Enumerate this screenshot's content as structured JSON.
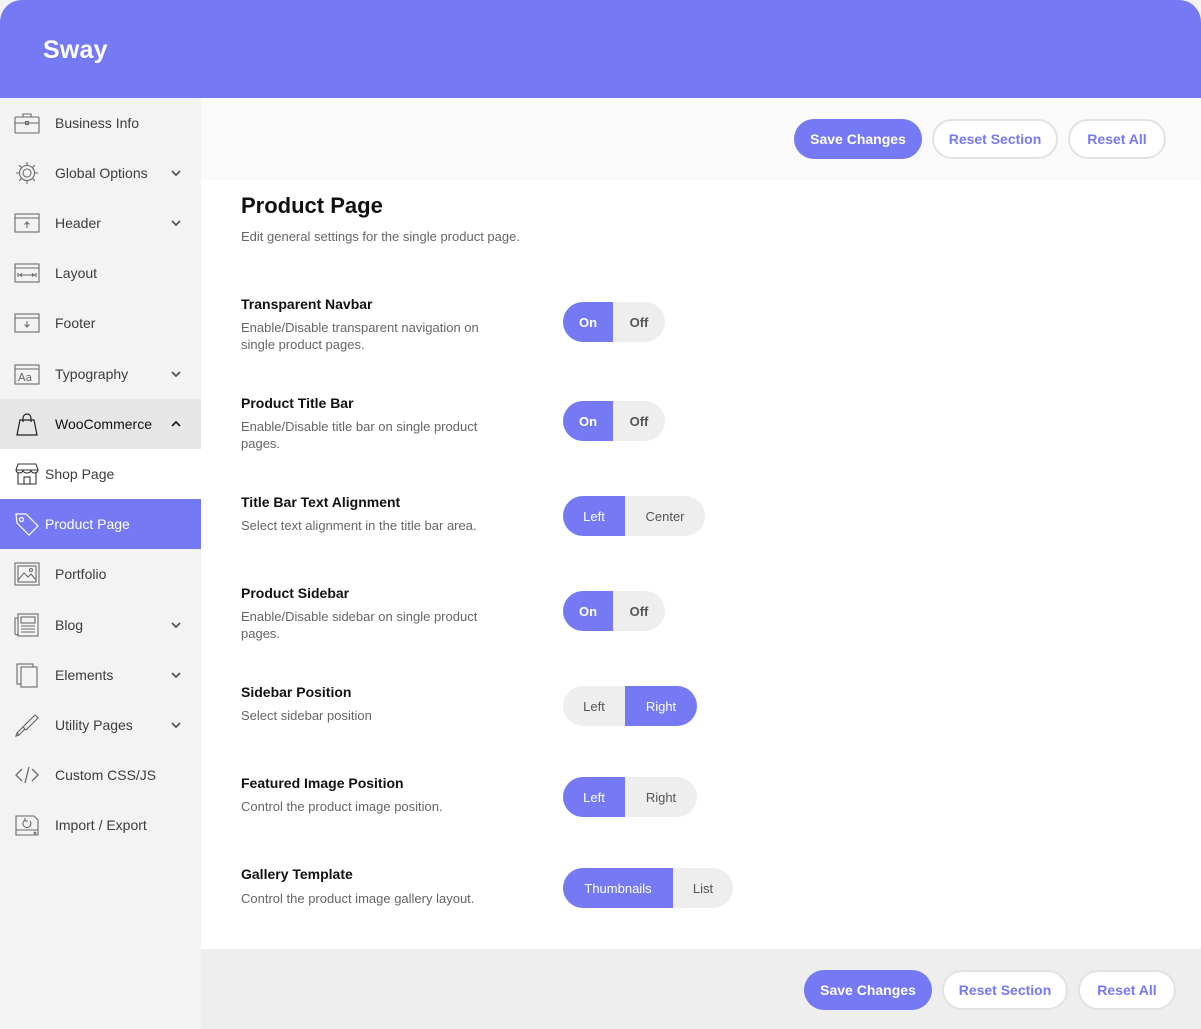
{
  "app": {
    "title": "Sway"
  },
  "colors": {
    "accent": "#7579f3",
    "sidebar_bg": "#f3f3f3",
    "panel_bg": "#ffffff"
  },
  "sidebar": {
    "items": [
      {
        "label": "Business Info",
        "icon": "briefcase-icon",
        "has_chevron": false
      },
      {
        "label": "Global Options",
        "icon": "gear-icon",
        "has_chevron": true
      },
      {
        "label": "Header",
        "icon": "header-layout-icon",
        "has_chevron": true
      },
      {
        "label": "Layout",
        "icon": "layout-width-icon",
        "has_chevron": false
      },
      {
        "label": "Footer",
        "icon": "footer-layout-icon",
        "has_chevron": false
      },
      {
        "label": "Typography",
        "icon": "typography-icon",
        "has_chevron": true
      },
      {
        "label": "WooCommerce",
        "icon": "shopping-bag-icon",
        "has_chevron": true,
        "expanded": true
      },
      {
        "label": "Shop Page",
        "icon": "storefront-icon",
        "sub": true
      },
      {
        "label": "Product Page",
        "icon": "price-tag-icon",
        "sub": true,
        "active": true
      },
      {
        "label": "Portfolio",
        "icon": "image-frame-icon",
        "has_chevron": false
      },
      {
        "label": "Blog",
        "icon": "newspaper-icon",
        "has_chevron": true
      },
      {
        "label": "Elements",
        "icon": "elements-icon",
        "has_chevron": true
      },
      {
        "label": "Utility Pages",
        "icon": "wrench-icon",
        "has_chevron": true
      },
      {
        "label": "Custom CSS/JS",
        "icon": "code-icon",
        "has_chevron": false
      },
      {
        "label": "Import / Export",
        "icon": "import-export-icon",
        "has_chevron": false
      }
    ]
  },
  "toolbar": {
    "save_label": "Save Changes",
    "reset_section_label": "Reset Section",
    "reset_all_label": "Reset All"
  },
  "page": {
    "title": "Product Page",
    "description": "Edit general settings for the single product page."
  },
  "settings": [
    {
      "title": "Transparent Navbar",
      "desc": "Enable/Disable transparent navigation on single product pages.",
      "options": [
        "On",
        "Off"
      ],
      "selected": "On"
    },
    {
      "title": "Product Title Bar",
      "desc": "Enable/Disable title bar on single product pages.",
      "options": [
        "On",
        "Off"
      ],
      "selected": "On"
    },
    {
      "title": "Title Bar Text Alignment",
      "desc": "Select text alignment in the title bar area.",
      "options": [
        "Left",
        "Center"
      ],
      "selected": "Left"
    },
    {
      "title": "Product Sidebar",
      "desc": "Enable/Disable sidebar on single product pages.",
      "options": [
        "On",
        "Off"
      ],
      "selected": "On"
    },
    {
      "title": "Sidebar Position",
      "desc": "Select sidebar position",
      "options": [
        "Left",
        "Right"
      ],
      "selected": "Right"
    },
    {
      "title": "Featured Image Position",
      "desc": "Control the product image position.",
      "options": [
        "Left",
        "Right"
      ],
      "selected": "Left"
    },
    {
      "title": "Gallery Template",
      "desc": "Control the product image gallery layout.",
      "options": [
        "Thumbnails",
        "List"
      ],
      "selected": "Thumbnails"
    }
  ]
}
